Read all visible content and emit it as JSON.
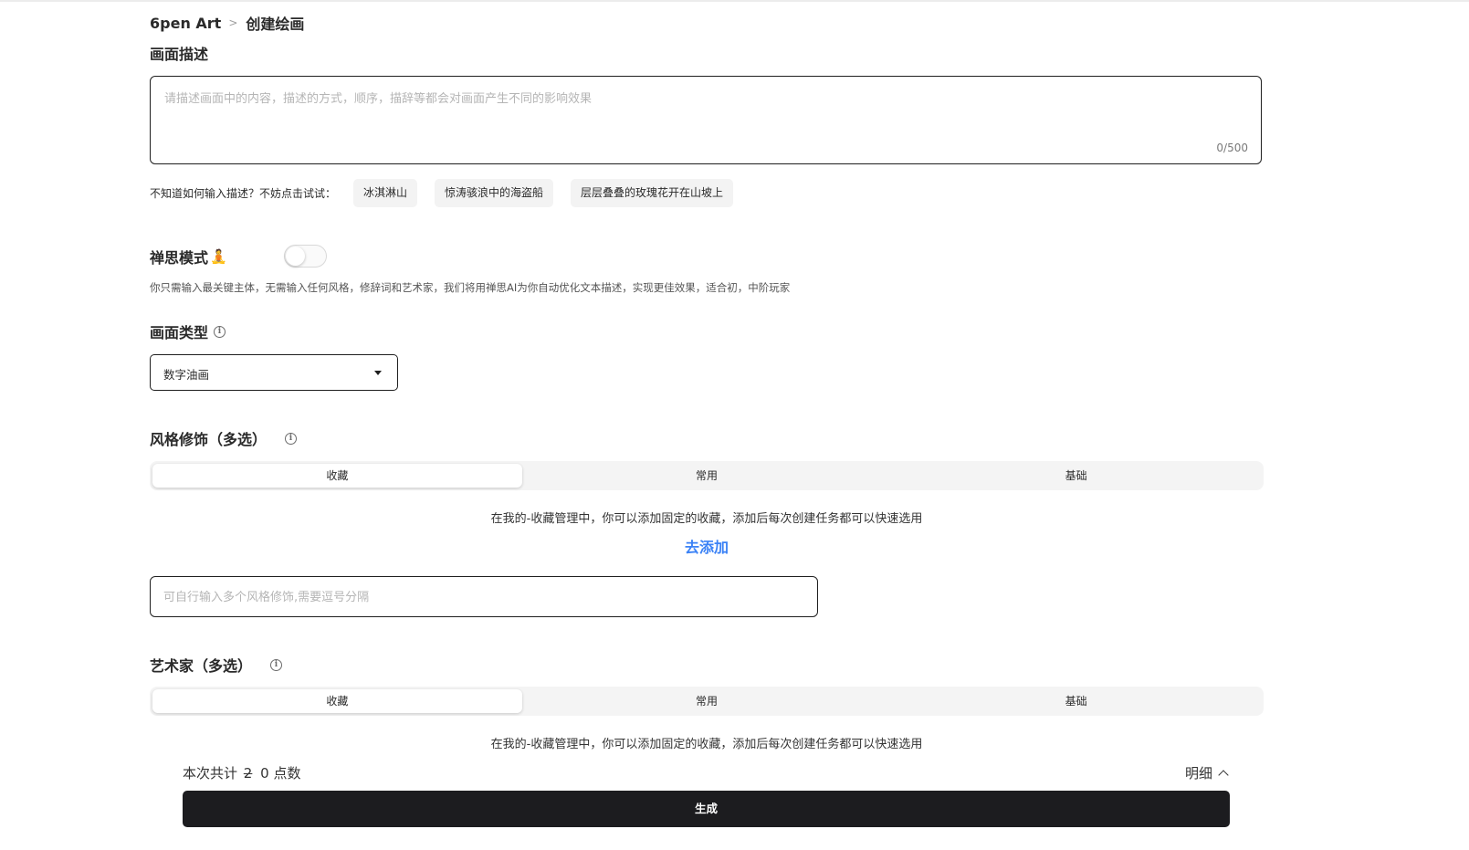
{
  "breadcrumb": {
    "root": "6pen Art",
    "separator": ">",
    "current": "创建绘画"
  },
  "description": {
    "title": "画面描述",
    "placeholder": "请描述画面中的内容，描述的方式，顺序，描辞等都会对画面产生不同的影响效果",
    "value": "",
    "counter": "0/500"
  },
  "suggestions": {
    "prompt": "不知道如何输入描述？不妨点击试试：",
    "items": [
      "冰淇淋山",
      "惊涛骇浪中的海盗船",
      "层层叠叠的玫瑰花开在山坡上"
    ]
  },
  "zen_mode": {
    "title": "禅思模式",
    "emoji": "🧘",
    "enabled": false,
    "hint": "你只需输入最关键主体，无需输入任何风格，修辞词和艺术家，我们将用禅思AI为你自动优化文本描述，实现更佳效果，适合初，中阶玩家"
  },
  "picture_type": {
    "title": "画面类型",
    "info_icon": "i",
    "selected": "数字油画"
  },
  "style": {
    "title": "风格修饰（多选）",
    "info_icon": "i",
    "tabs": [
      "收藏",
      "常用",
      "基础"
    ],
    "active_tab": 0,
    "empty_text": "在我的-收藏管理中，你可以添加固定的收藏，添加后每次创建任务都可以快速选用",
    "add_link": "去添加",
    "input_placeholder": "可自行输入多个风格修饰,需要逗号分隔"
  },
  "artist": {
    "title": "艺术家（多选）",
    "info_icon": "i",
    "tabs": [
      "收藏",
      "常用",
      "基础"
    ],
    "active_tab": 0,
    "empty_text": "在我的-收藏管理中，你可以添加固定的收藏，添加后每次创建任务都可以快速选用"
  },
  "footer": {
    "cost_prefix": "本次共计",
    "original_cost": "2",
    "cost": "0",
    "cost_unit": "点数",
    "detail_label": "明细",
    "generate_label": "生成"
  },
  "colors": {
    "accent_link": "#3b82f6",
    "button_bg": "#1c1c1f"
  }
}
